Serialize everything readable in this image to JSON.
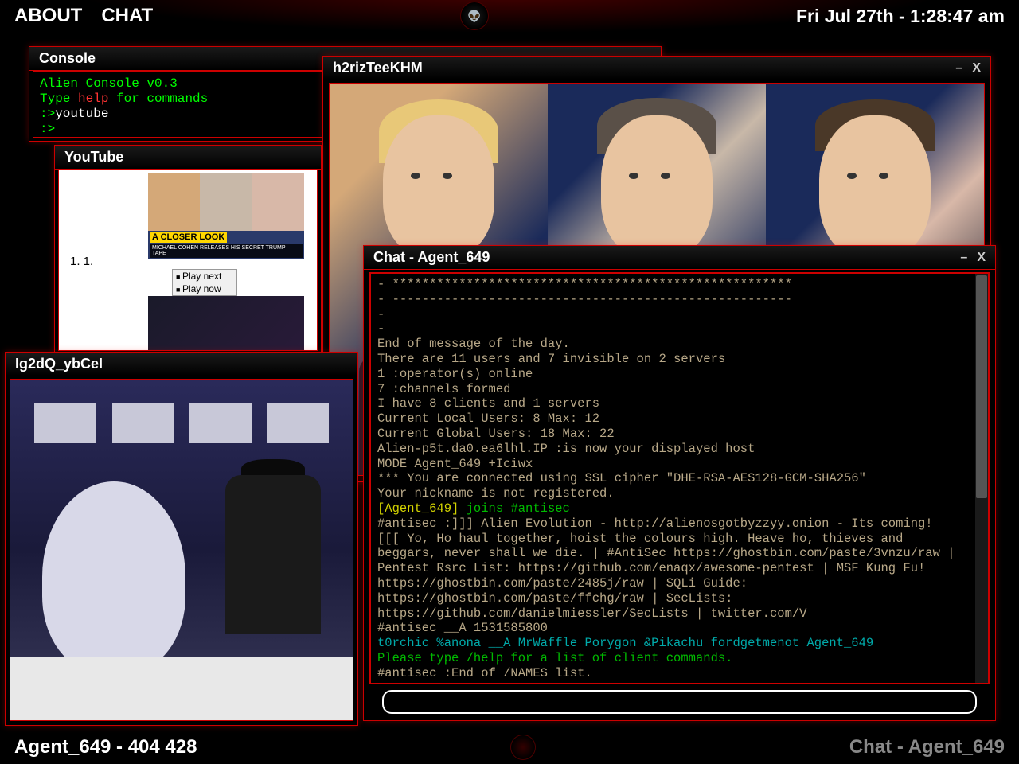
{
  "topbar": {
    "about": "ABOUT",
    "chat": "CHAT",
    "datetime": "Fri Jul 27th - 1:28:47 am"
  },
  "bottombar": {
    "left": "Agent_649 - 404 428",
    "right": "Chat - Agent_649"
  },
  "console": {
    "title": "Console",
    "line1a": "Alien Console v0.3",
    "line2a": "Type ",
    "line2b": "help",
    "line2c": " for commands",
    "line3a": ":>",
    "line3b": "youtube",
    "line4": ":>"
  },
  "youtube": {
    "title": "YouTube",
    "nums": "1.    1.    ",
    "play_next": "Play next",
    "play_now": "Play now",
    "closer": "A CLOSER LOOK",
    "sub": "MICHAEL COHEN RELEASES HIS SECRET TRUMP TAPE"
  },
  "bigvideo": {
    "title": "h2rizTeeKHM",
    "minimize": "–",
    "close": "X"
  },
  "smallvideo": {
    "title": "Ig2dQ_ybCeI"
  },
  "chat": {
    "title": "Chat - Agent_649",
    "minimize": "–",
    "close": "X",
    "lines": {
      "l1": "- ******************************************************",
      "l2": "- ------------------------------------------------------",
      "l3": "-",
      "l4": "-",
      "l5": "End of message of the day.",
      "l6": "There are 11 users and 7 invisible on 2 servers",
      "l7": "1 :operator(s) online",
      "l8": "7 :channels formed",
      "l9": "I have 8 clients and 1 servers",
      "l10": "Current Local Users: 8 Max: 12",
      "l11": "Current Global Users: 18 Max: 22",
      "l12": "Alien-p5t.da0.ea6lhl.IP :is now your displayed host",
      "l13": "MODE Agent_649 +Iciwx",
      "l14": "*** You are connected using SSL cipher \"DHE-RSA-AES128-GCM-SHA256\"",
      "l15": "Your nickname is not registered.",
      "l16a": "[Agent_649]",
      "l16b": " joins #antisec",
      "l17": "#antisec :]]] Alien Evolution - http://alienosgotbyzzyy.onion - Its coming!",
      "l18": "[[[ Yo, Ho haul together, hoist the colours high. Heave ho, thieves and beggars, never shall we die. | #AntiSec https://ghostbin.com/paste/3vnzu/raw | Pentest Rsrc List: https://github.com/enaqx/awesome-pentest | MSF Kung Fu! https://ghostbin.com/paste/2485j/raw | SQLi Guide: https://ghostbin.com/paste/ffchg/raw | SecLists: https://github.com/danielmiessler/SecLists | twitter.com/V",
      "l19": "#antisec __A 1531585800",
      "l20": "t0rchic %anona __A MrWaffle Porygon &Pikachu fordgetmenot Agent_649",
      "l21": "Please type /help for a list of client commands.",
      "l22": "#antisec :End of /NAMES list."
    }
  }
}
